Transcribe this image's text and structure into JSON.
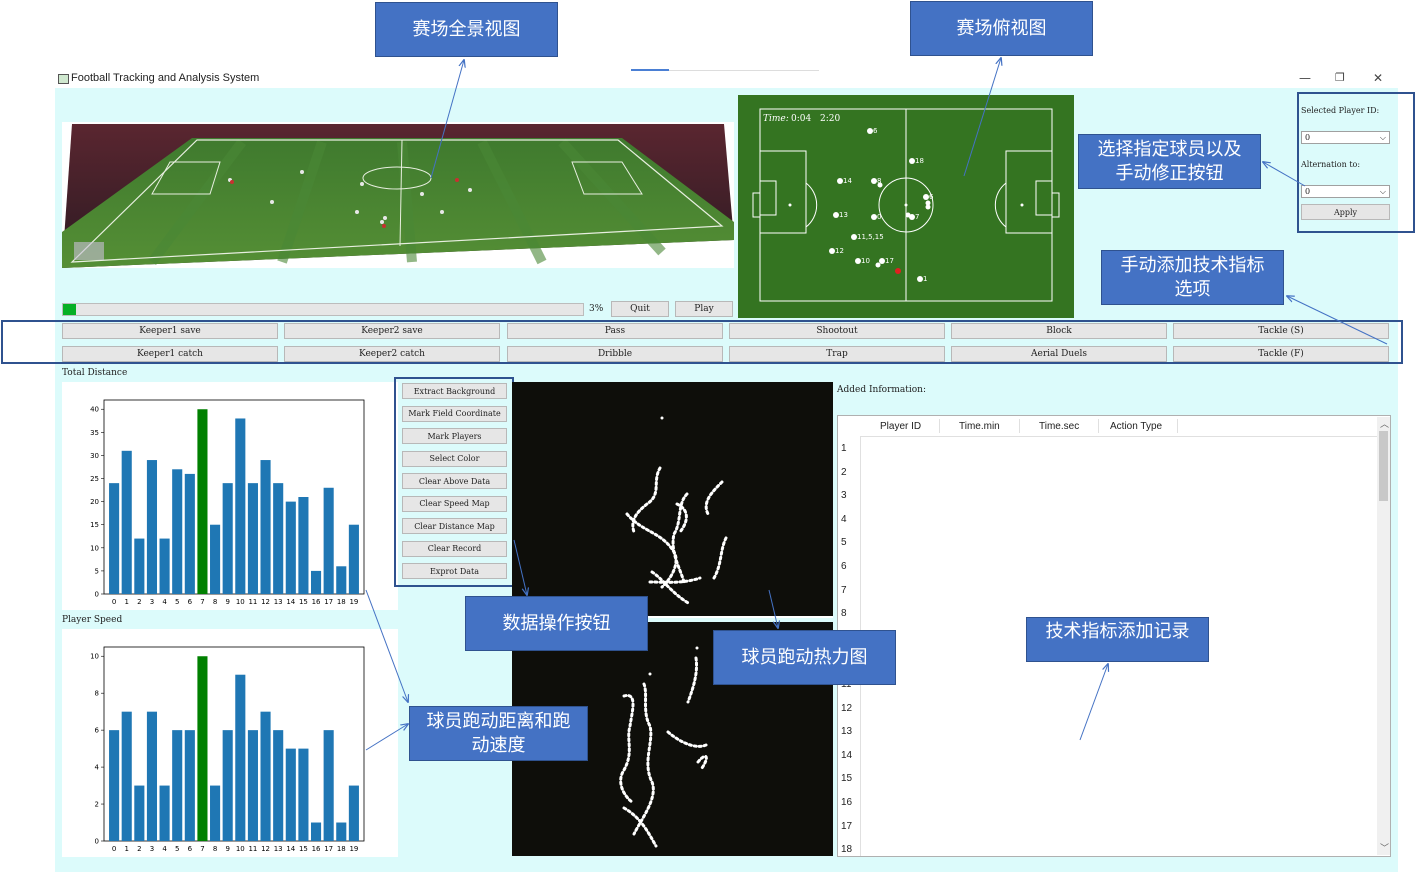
{
  "window": {
    "title": "Football Tracking and Analysis System",
    "minimize": "—",
    "restore": "❐",
    "close": "✕"
  },
  "panorama": {
    "name": "stadium-panorama"
  },
  "progress": {
    "percent_label": "3%",
    "value": 0.03
  },
  "playback": {
    "quit_label": "Quit",
    "play_label": "Play"
  },
  "topview": {
    "time_prefix": "Time:",
    "time_current": "0:04",
    "time_total": "2:20",
    "player_labels": [
      "6",
      "18",
      "14",
      "8",
      "6",
      "13",
      "7",
      "0",
      "12",
      "11,5,15",
      "10",
      "17",
      "1"
    ]
  },
  "selection": {
    "selected_label": "Selected Player ID:",
    "selected_value": "0",
    "alternation_label": "Alternation to:",
    "alternation_value": "0",
    "apply_label": "Apply"
  },
  "actions": {
    "row1": [
      "Keeper1 save",
      "Keeper2 save",
      "Pass",
      "Shootout",
      "Block",
      "Tackle (S)"
    ],
    "row2": [
      "Keeper1 catch",
      "Keeper2 catch",
      "Dribble",
      "Trap",
      "Aerial Duels",
      "Tackle (F)"
    ]
  },
  "data_ops": [
    "Extract Background",
    "Mark Field Coordinate",
    "Mark Players",
    "Select Color",
    "Clear Above Data",
    "Clear Speed Map",
    "Clear Distance Map",
    "Clear Record",
    "Exprot Data"
  ],
  "record": {
    "label": "Added Information:",
    "columns": [
      "Player ID",
      "Time.min",
      "Time.sec",
      "Action Type"
    ],
    "row_numbers": [
      "1",
      "2",
      "3",
      "4",
      "5",
      "6",
      "7",
      "8",
      "9",
      "10",
      "11",
      "12",
      "13",
      "14",
      "15",
      "16",
      "17",
      "18"
    ]
  },
  "callouts": {
    "panorama": "赛场全景视图",
    "topview": "赛场俯视图",
    "selection": "选择指定球员以及手动修正按钮",
    "actions": "手动添加技术指标选项",
    "data_ops": "数据操作按钮",
    "heatmap": "球员跑动热力图",
    "records": "技术指标添加记录",
    "charts": "球员跑动距离和跑动速度"
  },
  "chart_data": [
    {
      "type": "bar",
      "title": "Total Distance",
      "categories": [
        "0",
        "1",
        "2",
        "3",
        "4",
        "5",
        "6",
        "7",
        "8",
        "9",
        "10",
        "11",
        "12",
        "13",
        "14",
        "15",
        "16",
        "17",
        "18",
        "19"
      ],
      "values": [
        24,
        31,
        12,
        29,
        12,
        27,
        26,
        40,
        15,
        24,
        38,
        24,
        29,
        24,
        20,
        21,
        5,
        23,
        6,
        15
      ],
      "highlight_index": 7,
      "yticks": [
        0,
        5,
        10,
        15,
        20,
        25,
        30,
        35,
        40
      ],
      "ylim": [
        0,
        42
      ],
      "colors": {
        "bar": "#1f77b4",
        "highlight": "#008000"
      }
    },
    {
      "type": "bar",
      "title": "Player Speed",
      "categories": [
        "0",
        "1",
        "2",
        "3",
        "4",
        "5",
        "6",
        "7",
        "8",
        "9",
        "10",
        "11",
        "12",
        "13",
        "14",
        "15",
        "16",
        "17",
        "18",
        "19"
      ],
      "values": [
        6,
        7,
        3,
        7,
        3,
        6,
        6,
        10,
        3,
        6,
        9,
        6,
        7,
        6,
        5,
        5,
        1,
        6,
        1,
        3
      ],
      "highlight_index": 7,
      "yticks": [
        0,
        2,
        4,
        6,
        8,
        10
      ],
      "ylim": [
        0,
        10.5
      ],
      "colors": {
        "bar": "#1f77b4",
        "highlight": "#008000"
      }
    }
  ]
}
